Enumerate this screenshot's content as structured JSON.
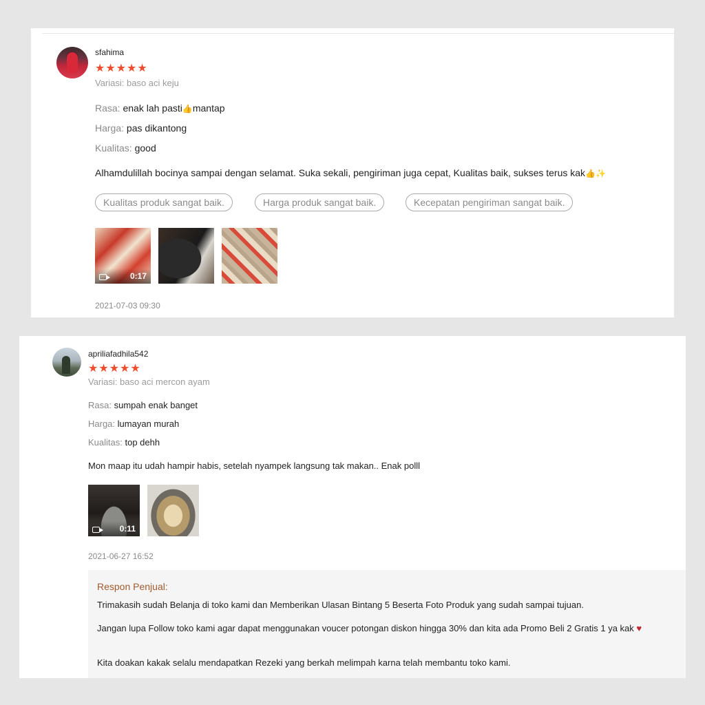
{
  "reviews": [
    {
      "username": "sfahima",
      "stars": "★★★★★",
      "variant": "Variasi: baso aci keju",
      "attributes": [
        {
          "label": "Rasa:",
          "value": "enak lah pasti",
          "value2": "mantap"
        },
        {
          "label": "Harga:",
          "value": "pas dikantong"
        },
        {
          "label": "Kualitas:",
          "value": "good"
        }
      ],
      "comment": "Alhamdulillah bocinya sampai dengan selamat. Suka sekali, pengiriman juga cepat, Kualitas baik, sukses terus kak",
      "tags": [
        "Kualitas produk sangat baik.",
        "Harga produk sangat baik.",
        "Kecepatan pengiriman sangat baik."
      ],
      "media": [
        {
          "type": "video",
          "duration": "0:17",
          "icon": "video-camera-icon"
        },
        {
          "type": "image"
        },
        {
          "type": "image"
        }
      ],
      "date": "2021-07-03 09:30"
    },
    {
      "username": "apriliafadhila542",
      "stars": "★★★★★",
      "variant": "Variasi: baso aci mercon ayam",
      "attributes": [
        {
          "label": "Rasa:",
          "value": "sumpah enak banget"
        },
        {
          "label": "Harga:",
          "value": "lumayan murah"
        },
        {
          "label": "Kualitas:",
          "value": "top dehh"
        }
      ],
      "comment": "Mon maap itu udah hampir habis, setelah nyampek langsung tak makan.. Enak polll",
      "media": [
        {
          "type": "video",
          "duration": "0:11",
          "icon": "video-camera-icon"
        },
        {
          "type": "image"
        }
      ],
      "date": "2021-06-27 16:52",
      "seller_response": {
        "heading": "Respon Penjual:",
        "paragraphs": [
          "Trimakasih sudah Belanja di toko kami dan Memberikan Ulasan Bintang 5 Beserta Foto Produk yang sudah sampai tujuan.",
          "Jangan lupa Follow toko kami agar dapat menggunakan voucer potongan diskon hingga 30% dan kita ada Promo Beli 2 Gratis 1 ya kak",
          "Kita doakan kakak selalu mendapatkan Rezeki yang berkah melimpah karna telah membantu toko kami."
        ]
      }
    }
  ],
  "colors": {
    "star": "#ee4d2d",
    "background": "#e6e6e6",
    "card": "#ffffff",
    "reply_bg": "#f5f5f5",
    "reply_heading": "#a05a2c"
  },
  "emoji": {
    "thumb": "👍",
    "sparkle": "✨",
    "heart": "♥"
  }
}
